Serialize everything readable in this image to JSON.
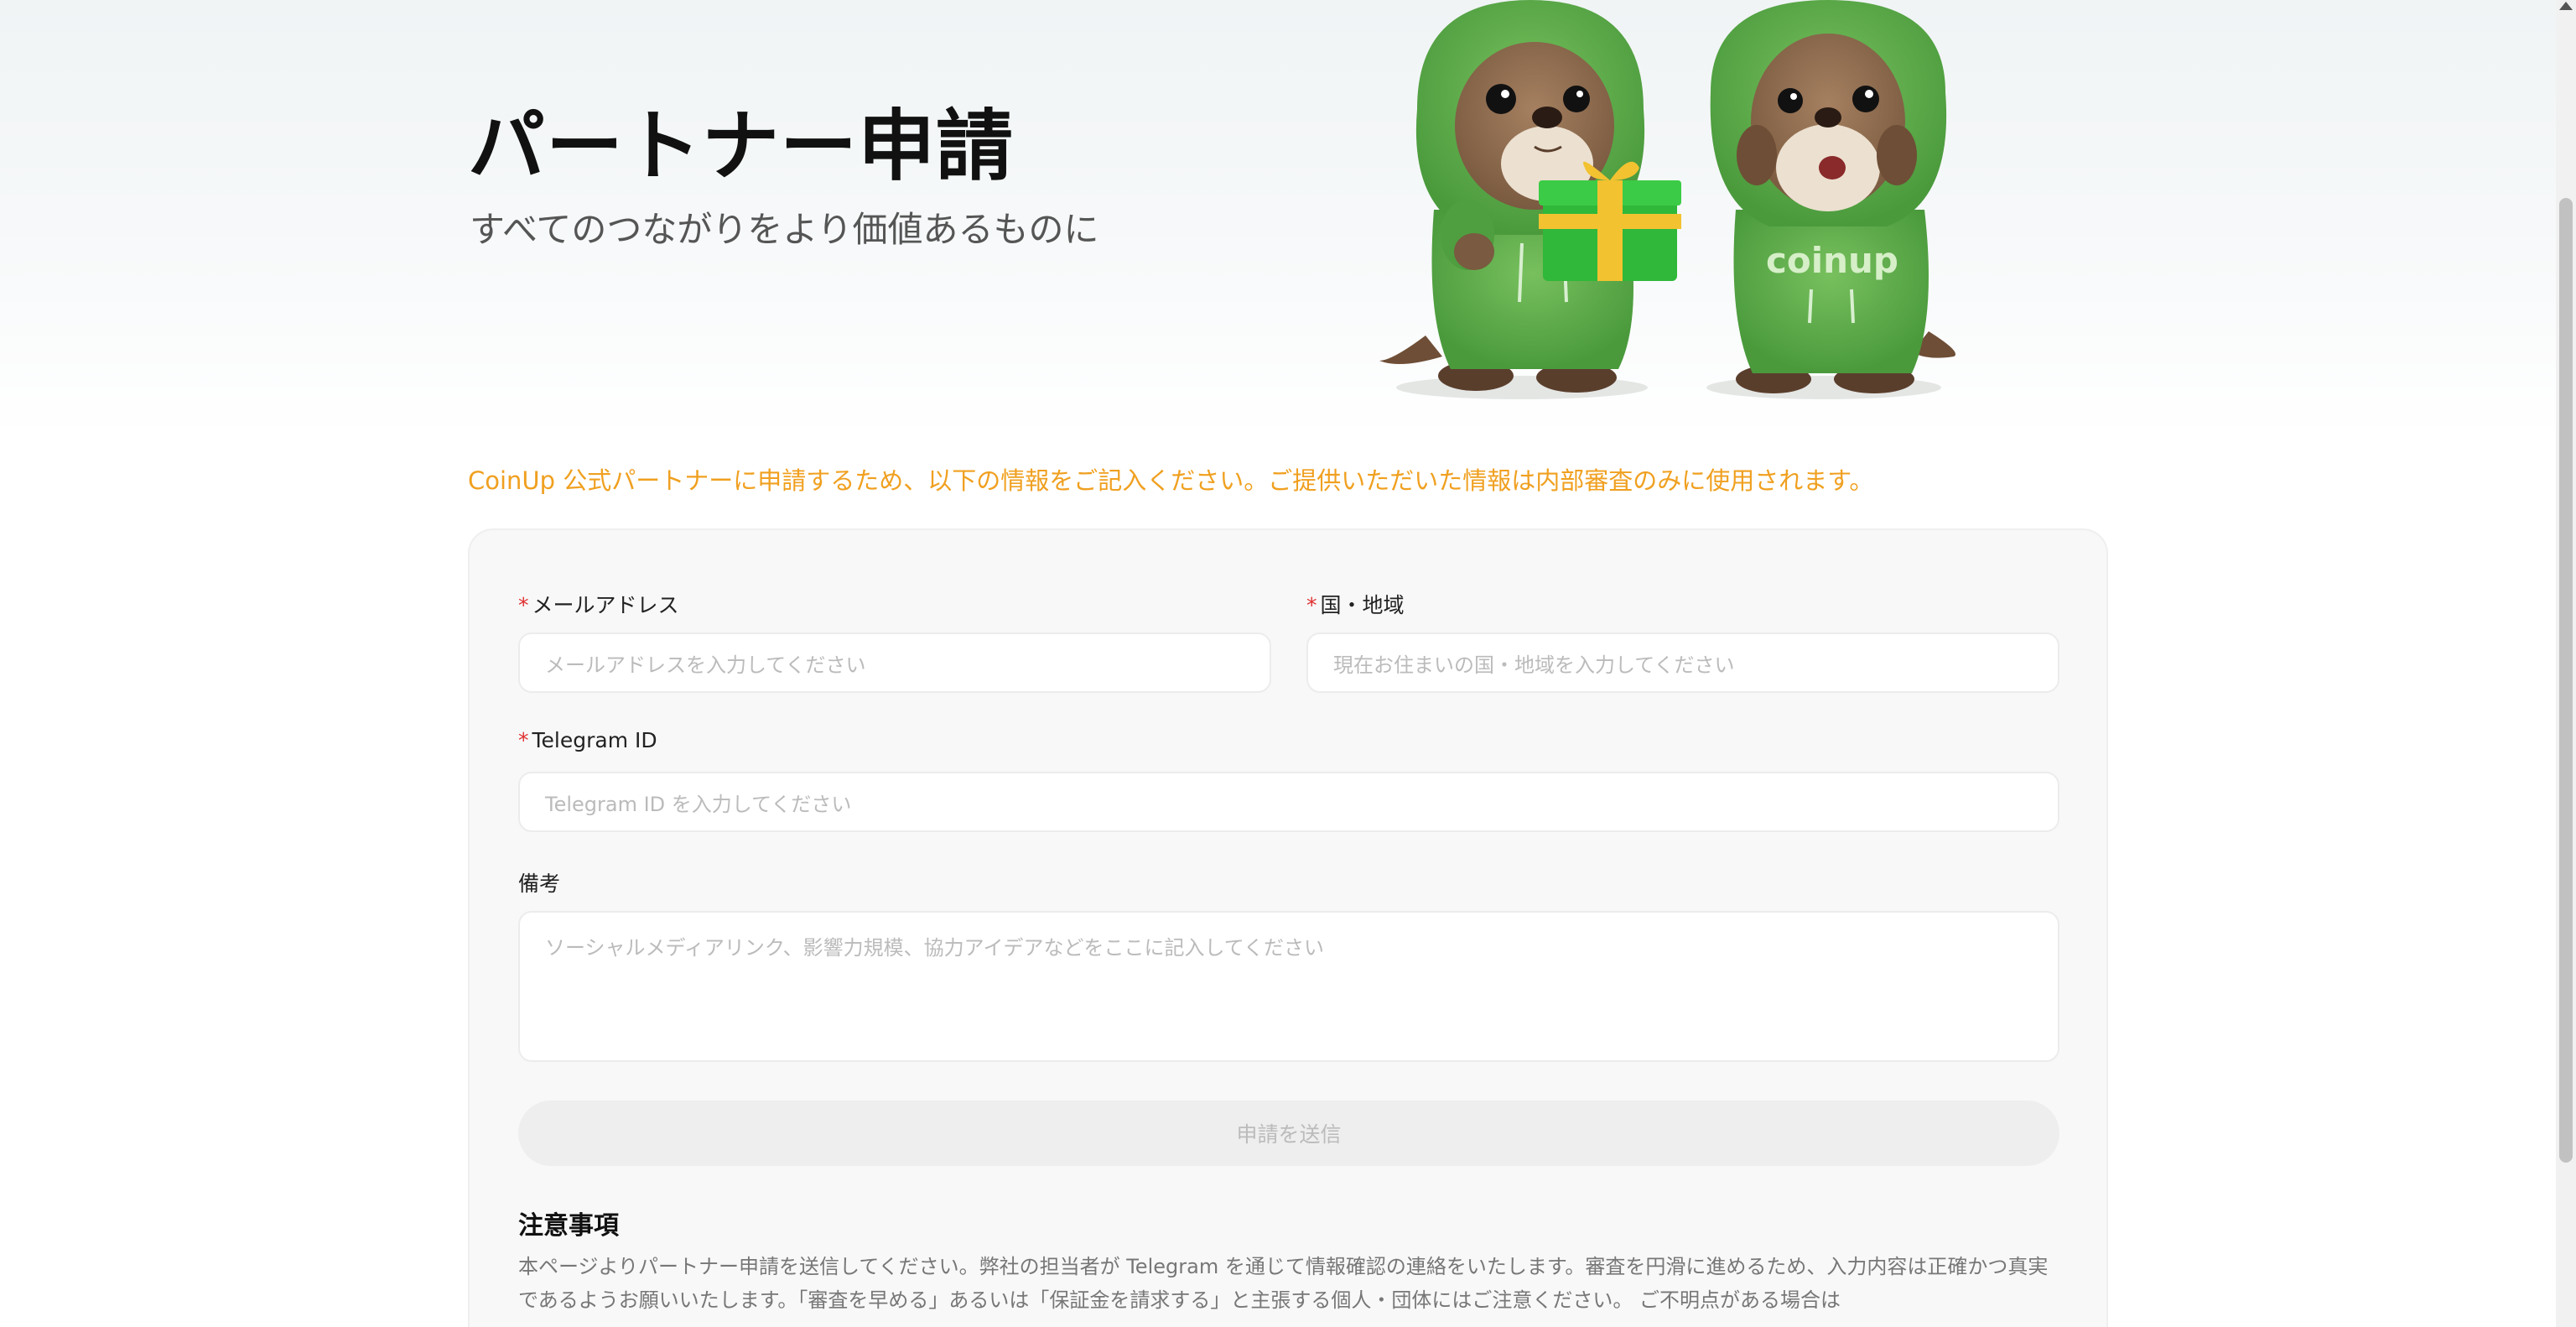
{
  "hero": {
    "title": "パートナー申請",
    "subtitle": "すべてのつながりをより価値あるものに",
    "mascot_logo_text": "coinup"
  },
  "notice_line": "CoinUp 公式パートナーに申請するため、以下の情報をご記入ください。ご提供いただいた情報は内部審査のみに使用されます。",
  "form": {
    "email": {
      "required_mark": "*",
      "label": "メールアドレス",
      "placeholder": "メールアドレスを入力してください",
      "value": ""
    },
    "country": {
      "required_mark": "*",
      "label": "国・地域",
      "placeholder": "現在お住まいの国・地域を入力してください",
      "value": ""
    },
    "telegram": {
      "required_mark": "*",
      "label": "Telegram ID",
      "placeholder": "Telegram ID を入力してください",
      "value": ""
    },
    "remarks": {
      "label": "備考",
      "placeholder": "ソーシャルメディアリンク、影響力規模、協力アイデアなどをここに記入してください",
      "value": ""
    },
    "submit_label": "申請を送信"
  },
  "notes": {
    "title": "注意事項",
    "body": "本ページよりパートナー申請を送信してください。弊社の担当者が Telegram を通じて情報確認の連絡をいたします。審査を円滑に進めるため、入力内容は正確かつ真実であるようお願いいたします。「審査を早める」あるいは「保証金を請求する」と主張する個人・団体にはご注意ください。 ご不明点がある場合は"
  },
  "colors": {
    "accent_orange": "#f0a020",
    "required_red": "#e03030",
    "hoodie_green": "#5aa84a",
    "gift_green": "#2fb83a",
    "ribbon_gold": "#f2c230"
  }
}
